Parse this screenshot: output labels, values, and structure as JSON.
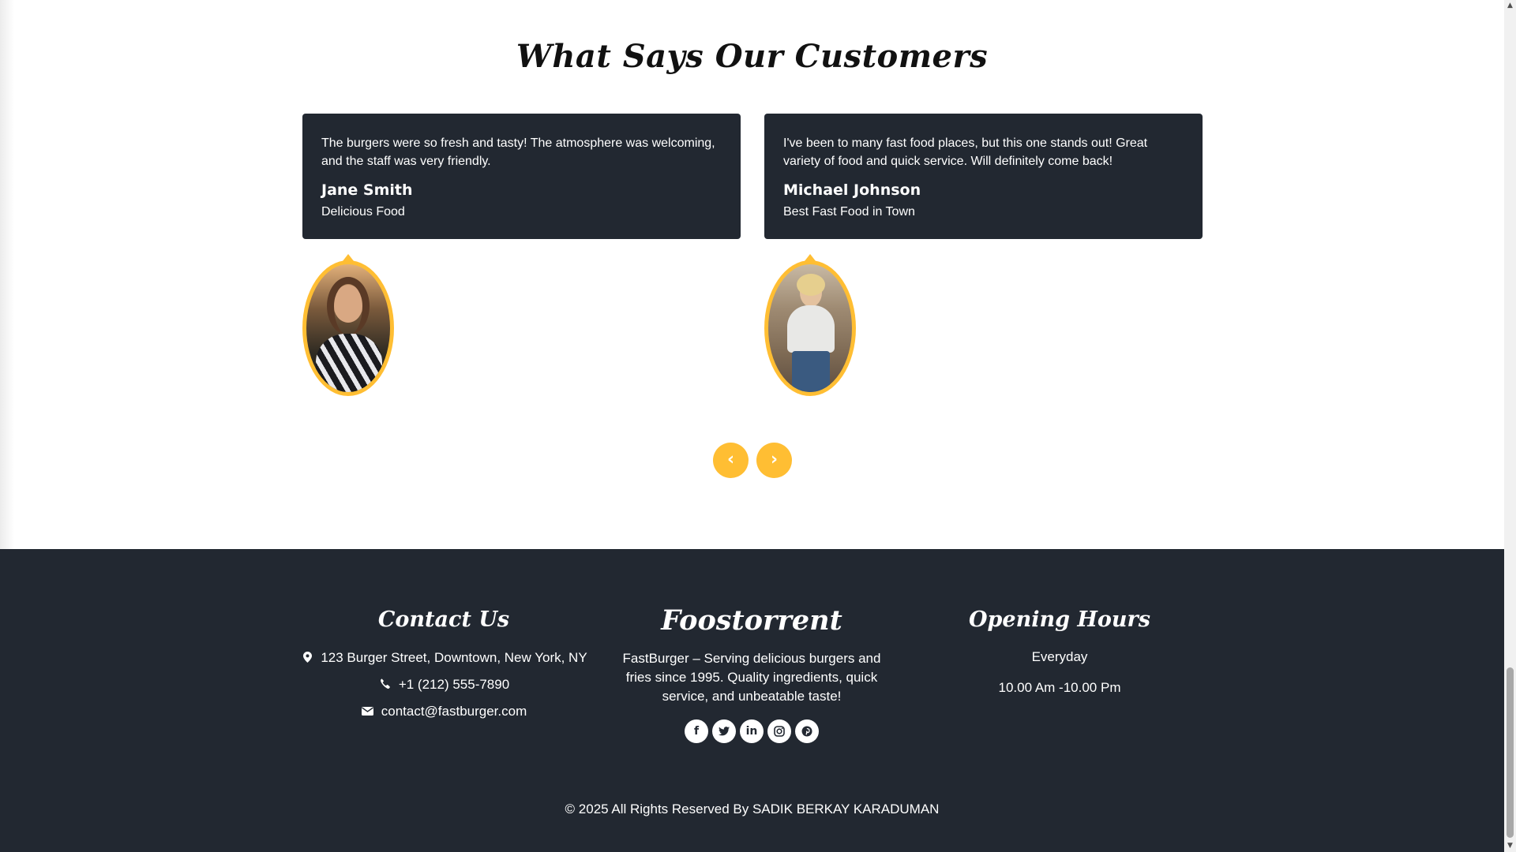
{
  "testimonials": {
    "title": "What Says Our Customers",
    "items": [
      {
        "quote": "The burgers were so fresh and tasty! The atmosphere was welcoming, and the staff was very friendly.",
        "name": "Jane Smith",
        "subtitle": "Delicious Food"
      },
      {
        "quote": "I've been to many fast food places, but this one stands out! Great variety of food and quick service. Will definitely come back!",
        "name": "Michael Johnson",
        "subtitle": "Best Fast Food in Town"
      }
    ],
    "prev_icon": "‹",
    "next_icon": "›"
  },
  "footer": {
    "contact": {
      "title": "Contact Us",
      "address": "123 Burger Street, Downtown, New York, NY",
      "phone": "+1 (212) 555-7890",
      "email": "contact@fastburger.com"
    },
    "brand": {
      "title": "Foostorrent",
      "text": "FastBurger – Serving delicious burgers and fries since 1995. Quality ingredients, quick service, and unbeatable taste!",
      "social_icons": [
        "facebook-icon",
        "twitter-icon",
        "linkedin-icon",
        "instagram-icon",
        "pinterest-icon"
      ]
    },
    "hours": {
      "title": "Opening Hours",
      "days": "Everyday",
      "time": "10.00 Am -10.00 Pm"
    },
    "copyright": "© 2025 All Rights Reserved By SADIK BERKAY KARADUMAN"
  },
  "colors": {
    "accent": "#ffbe33",
    "dark": "#222831",
    "white": "#ffffff"
  }
}
